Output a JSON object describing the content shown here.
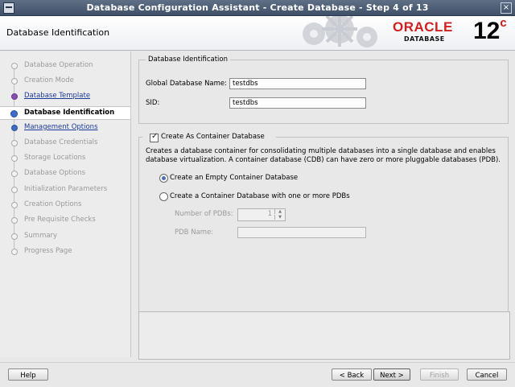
{
  "window": {
    "title": "Database Configuration Assistant - Create Database - Step 4 of 13"
  },
  "header": {
    "title": "Database Identification",
    "logo_brand": "ORACLE",
    "logo_product": "DATABASE",
    "logo_version": "12",
    "logo_version_suffix": "c"
  },
  "steps": [
    {
      "label": "Database Operation",
      "state": "disabled"
    },
    {
      "label": "Creation Mode",
      "state": "disabled"
    },
    {
      "label": "Database Template",
      "state": "done"
    },
    {
      "label": "Database Identification",
      "state": "current"
    },
    {
      "label": "Management Options",
      "state": "next"
    },
    {
      "label": "Database Credentials",
      "state": "disabled"
    },
    {
      "label": "Storage Locations",
      "state": "disabled"
    },
    {
      "label": "Database Options",
      "state": "disabled"
    },
    {
      "label": "Initialization Parameters",
      "state": "disabled"
    },
    {
      "label": "Creation Options",
      "state": "disabled"
    },
    {
      "label": "Pre Requisite Checks",
      "state": "disabled"
    },
    {
      "label": "Summary",
      "state": "disabled"
    },
    {
      "label": "Progress Page",
      "state": "disabled"
    }
  ],
  "identification": {
    "group_title": "Database Identification",
    "global_name_label": "Global Database Name:",
    "global_name_value": "testdbs",
    "sid_label": "SID:",
    "sid_value": "testdbs"
  },
  "container": {
    "checkbox_label": "Create As Container Database",
    "checked": true,
    "description_line1": "Creates a database container for consolidating multiple databases into a single database and enables",
    "description_line2": "database virtualization. A container database (CDB) can have zero or more pluggable databases (PDB).",
    "radio_empty_label": "Create an Empty Container Database",
    "radio_with_pdbs_label": "Create a Container Database with one or more PDBs",
    "selected_option": "empty",
    "num_pdbs_label": "Number of PDBs:",
    "num_pdbs_value": "1",
    "pdb_name_label": "PDB Name:",
    "pdb_name_value": ""
  },
  "buttons": {
    "help": "Help",
    "back": "< Back",
    "next": "Next >",
    "finish": "Finish",
    "cancel": "Cancel"
  }
}
